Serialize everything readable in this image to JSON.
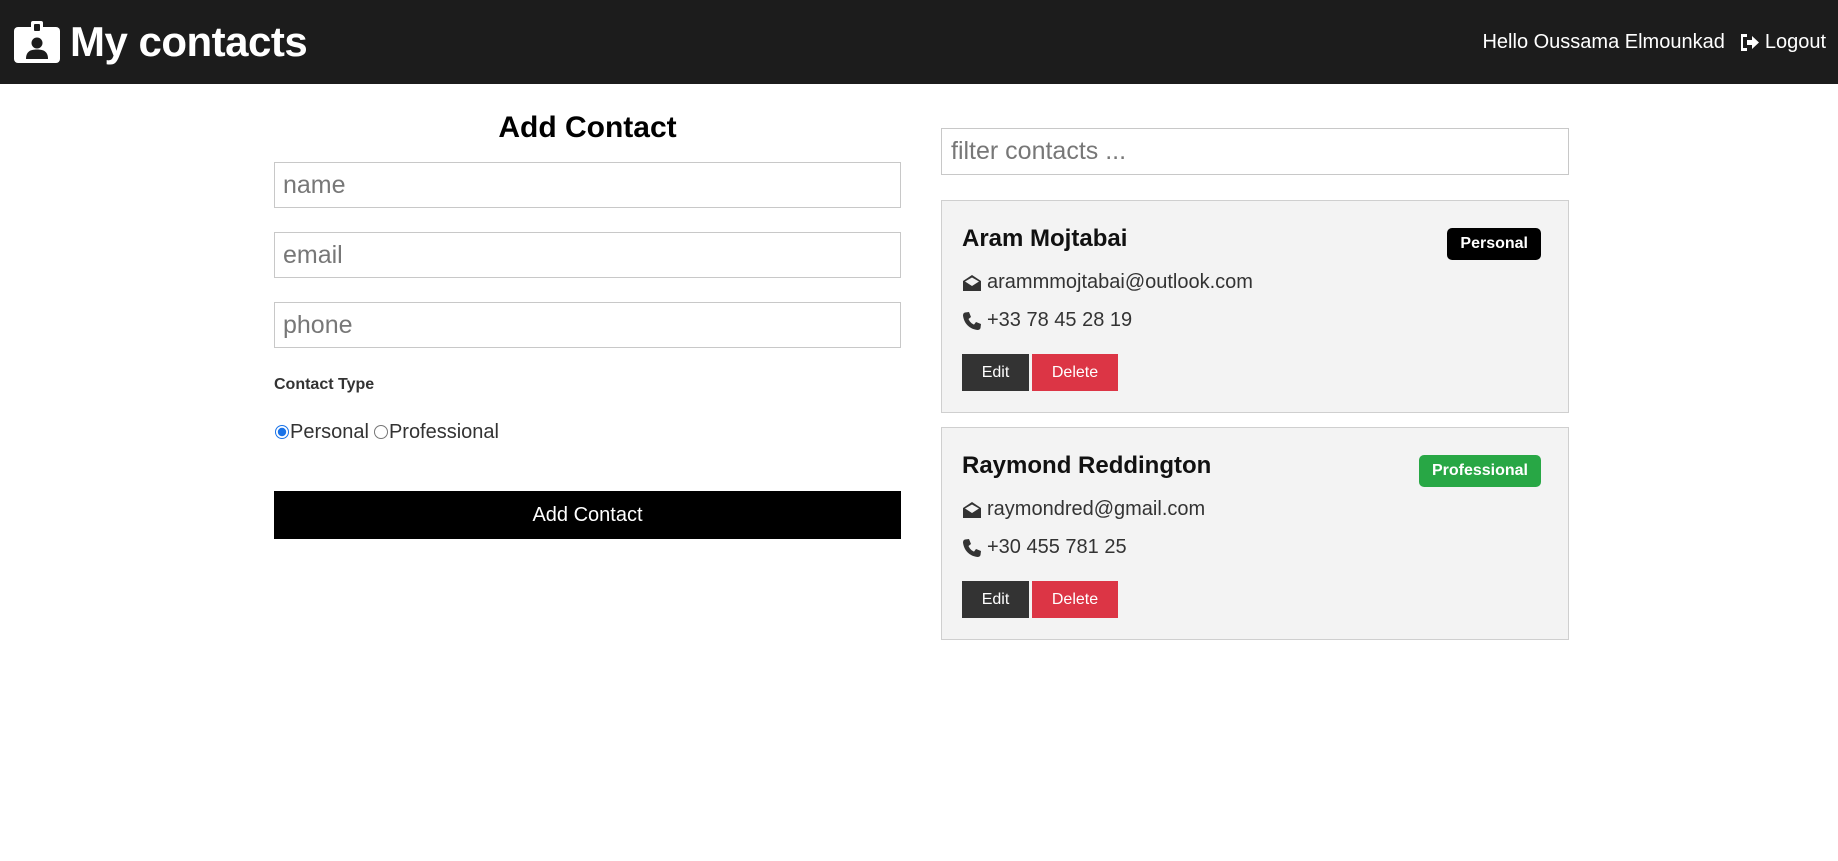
{
  "navbar": {
    "title": "My contacts",
    "brand_icon": "id-badge-icon",
    "greeting": "Hello Oussama Elmounkad",
    "logout_label": "Logout",
    "logout_icon": "sign-out-icon",
    "background": "#1c1c1c"
  },
  "form": {
    "title": "Add Contact",
    "name_placeholder": "name",
    "email_placeholder": "email",
    "phone_placeholder": "phone",
    "type_label": "Contact Type",
    "options": [
      {
        "label": "Personal",
        "selected": true
      },
      {
        "label": "Professional",
        "selected": false
      }
    ],
    "submit_label": "Add Contact"
  },
  "filter": {
    "placeholder": "filter contacts ..."
  },
  "contacts": [
    {
      "name": "Aram Mojtabai",
      "email": "arammmojtabai@outlook.com",
      "phone": "+33 78 45 28 19",
      "type": "Personal",
      "badge_color": "#000000",
      "edit_label": "Edit",
      "delete_label": "Delete"
    },
    {
      "name": "Raymond Reddington",
      "email": "raymondred@gmail.com",
      "phone": "+30 455 781 25",
      "type": "Professional",
      "badge_color": "#28a745",
      "edit_label": "Edit",
      "delete_label": "Delete"
    }
  ],
  "colors": {
    "edit_button": "#333333",
    "delete_button": "#dc3545",
    "submit_button": "#000000",
    "card_background": "#f3f3f3"
  }
}
